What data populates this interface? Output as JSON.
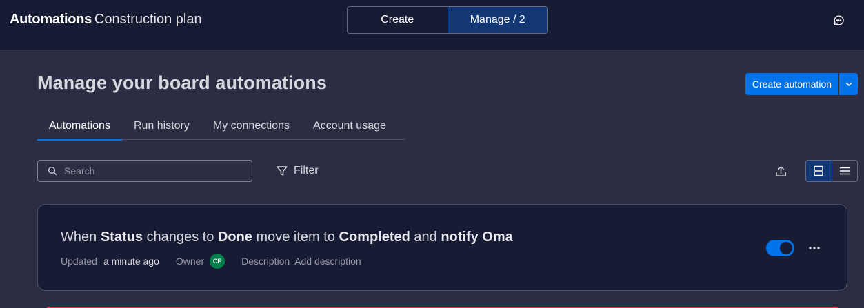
{
  "header": {
    "app_name": "Automations",
    "board_name": "Construction plan",
    "mode_create": "Create",
    "mode_manage": "Manage / 2",
    "feedback_icon": "chat-feedback-icon"
  },
  "page": {
    "title": "Manage your board automations",
    "create_button": "Create automation"
  },
  "tabs": [
    {
      "label": "Automations",
      "active": true
    },
    {
      "label": "Run history",
      "active": false
    },
    {
      "label": "My connections",
      "active": false
    },
    {
      "label": "Account usage",
      "active": false
    }
  ],
  "toolbar": {
    "search_placeholder": "Search",
    "filter_label": "Filter"
  },
  "automation": {
    "recipe_parts": {
      "p1": "When ",
      "b1": "Status",
      "p2": " changes to ",
      "b2": "Done",
      "p3": " move item to ",
      "b3": "Completed",
      "p4": " and ",
      "b4": "notify Oma"
    },
    "updated_label": "Updated",
    "updated_value": "a minute ago",
    "owner_label": "Owner",
    "owner_initials": "CE",
    "description_label": "Description",
    "description_action": "Add description",
    "enabled": true
  },
  "colors": {
    "accent": "#0073ea",
    "background": "#2b2d42",
    "surface": "#181b34",
    "owner_avatar": "#037f4c"
  }
}
